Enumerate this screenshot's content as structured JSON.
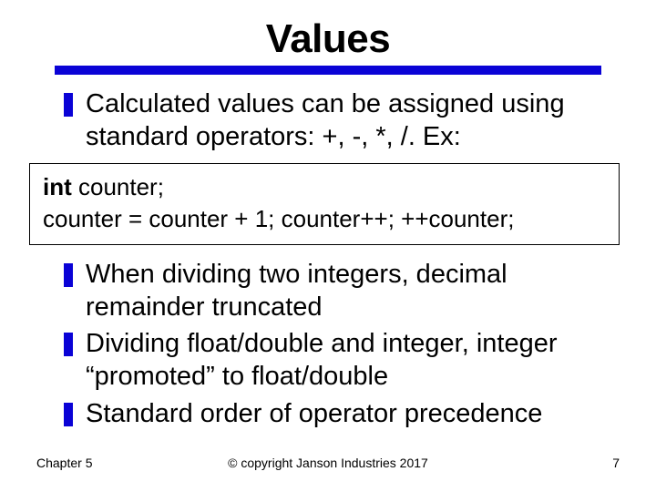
{
  "title": "Values",
  "bullets_top": [
    "Calculated values can be assigned using standard operators: +, -, *, /.  Ex:"
  ],
  "code": {
    "kw": "int",
    "rest1": " counter;",
    "line2": "counter = counter + 1; counter++; ++counter;"
  },
  "bullets_bottom": [
    "When dividing two integers, decimal remainder truncated",
    "Dividing float/double and integer, integer “promoted” to float/double",
    "Standard order of operator precedence"
  ],
  "footer": {
    "left": "Chapter 5",
    "center": "© copyright Janson Industries 2017",
    "right": "7"
  }
}
